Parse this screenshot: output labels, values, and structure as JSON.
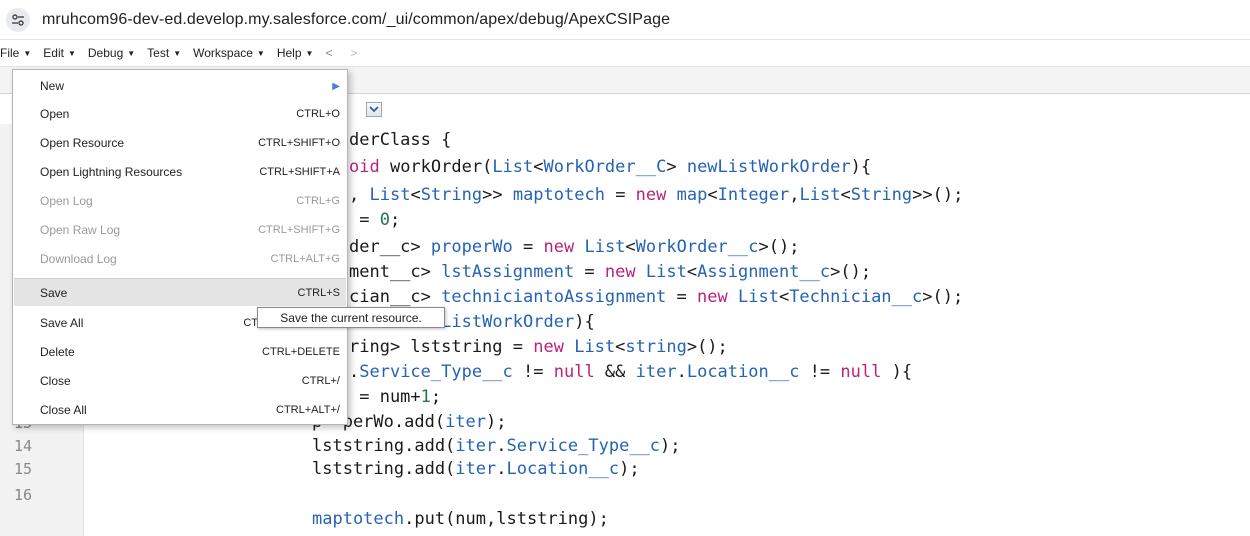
{
  "url_bar": {
    "url": "mruhcom96-dev-ed.develop.my.salesforce.com/_ui/common/apex/debug/ApexCSIPage",
    "site_icon": "tune-icon"
  },
  "menubar": {
    "items": [
      {
        "label": "File"
      },
      {
        "label": "Edit"
      },
      {
        "label": "Debug"
      },
      {
        "label": "Test"
      },
      {
        "label": "Workspace"
      },
      {
        "label": "Help"
      }
    ],
    "back_glyph": "<",
    "forward_glyph": ">"
  },
  "file_menu": {
    "items": [
      {
        "label": "New",
        "shortcut": "",
        "submenu": true,
        "disabled": false
      },
      {
        "label": "Open",
        "shortcut": "CTRL+O",
        "disabled": false
      },
      {
        "label": "Open Resource",
        "shortcut": "CTRL+SHIFT+O",
        "disabled": false
      },
      {
        "label": "Open Lightning Resources",
        "shortcut": "CTRL+SHIFT+A",
        "disabled": false
      },
      {
        "label": "Open Log",
        "shortcut": "CTRL+G",
        "disabled": true
      },
      {
        "label": "Open Raw Log",
        "shortcut": "CTRL+SHIFT+G",
        "disabled": true
      },
      {
        "label": "Download Log",
        "shortcut": "CTRL+ALT+G",
        "disabled": true
      },
      {
        "label": "Save",
        "shortcut": "CTRL+S",
        "disabled": false,
        "hovered": true
      },
      {
        "label": "Save All",
        "shortcut": "CT",
        "disabled": false
      },
      {
        "label": "Delete",
        "shortcut": "CTRL+DELETE",
        "disabled": false
      },
      {
        "label": "Close",
        "shortcut": "CTRL+/",
        "disabled": false
      },
      {
        "label": "Close All",
        "shortcut": "CTRL+ALT+/",
        "disabled": false
      }
    ]
  },
  "tooltip": {
    "text": "Save the current resource."
  },
  "editor": {
    "line_numbers": [
      "13",
      "14",
      "15",
      "16"
    ],
    "code_lines": [
      "derClass {",
      "oid workOrder(List<WorkOrder__C> newListWorkOrder){",
      ", List<String>> maptotech = new map<Integer,List<String>>();",
      " = 0;",
      "der__c> properWo = new List<WorkOrder__c>();",
      "ment__c> lstAssignment = new List<Assignment__c>();",
      "cian__c> techniciantoAssignment = new List<Technician__c>();",
      "ter : newListWorkOrder){",
      "ring> lststring = new List<string>();",
      ".Service_Type__c != null && iter.Location__c != null ){",
      " = num+1;",
      "p  perWo.add(iter);",
      "lststring.add(iter.Service_Type__c);",
      "lststring.add(iter.Location__c);",
      "",
      "maptotech.put(num,lststring);"
    ]
  },
  "colors": {
    "keyword": "#b8247a",
    "type": "#2563b3",
    "number": "#1e7a43",
    "menu_hover": "#e4e4e4",
    "submenu_arrow": "#4a7fd8"
  }
}
